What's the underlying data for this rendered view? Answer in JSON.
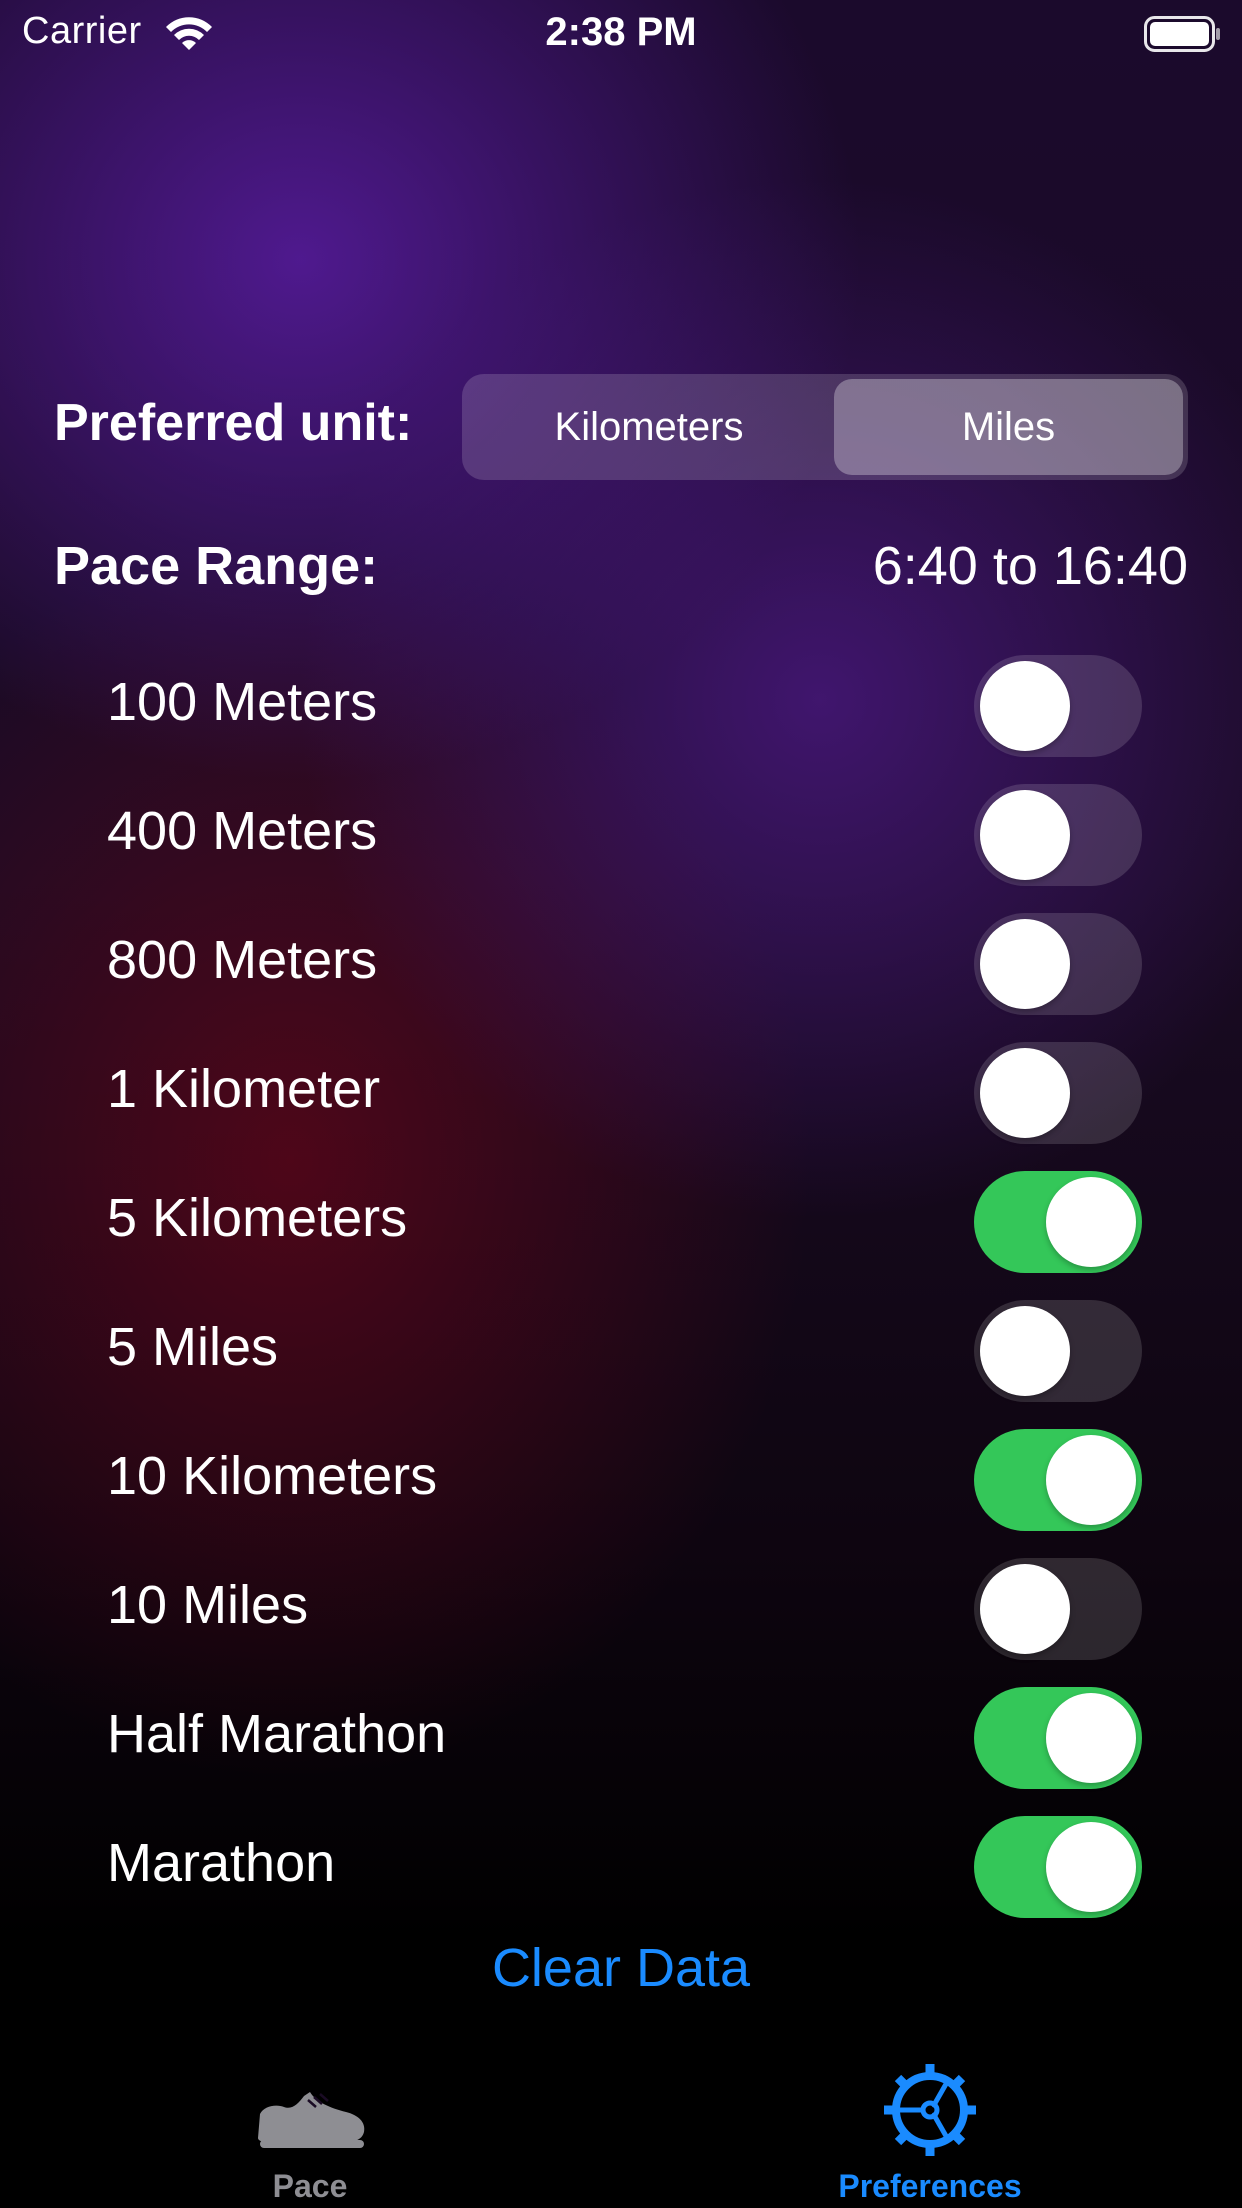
{
  "status_bar": {
    "carrier": "Carrier",
    "time": "2:38 PM",
    "wifi_icon": "wifi-icon",
    "battery_icon": "battery-icon"
  },
  "preferences": {
    "unit_label": "Preferred unit:",
    "unit_options": [
      "Kilometers",
      "Miles"
    ],
    "selected_unit": "Miles",
    "pace_range_label": "Pace Range:",
    "pace_range_value": "6:40 to 16:40",
    "distances": [
      {
        "label": "100 Meters",
        "enabled": false
      },
      {
        "label": "400 Meters",
        "enabled": false
      },
      {
        "label": "800 Meters",
        "enabled": false
      },
      {
        "label": "1 Kilometer",
        "enabled": false
      },
      {
        "label": "5 Kilometers",
        "enabled": true
      },
      {
        "label": "5 Miles",
        "enabled": false
      },
      {
        "label": "10 Kilometers",
        "enabled": true
      },
      {
        "label": "10 Miles",
        "enabled": false
      },
      {
        "label": "Half Marathon",
        "enabled": true
      },
      {
        "label": "Marathon",
        "enabled": true
      }
    ],
    "clear_data_label": "Clear Data"
  },
  "tab_bar": {
    "tabs": [
      {
        "label": "Pace",
        "icon": "shoe-icon",
        "selected": false
      },
      {
        "label": "Preferences",
        "icon": "gear-icon",
        "selected": true
      }
    ]
  },
  "colors": {
    "accent": "#1a8bff",
    "toggle_on": "#34c759",
    "tab_inactive": "#8e8e93"
  }
}
